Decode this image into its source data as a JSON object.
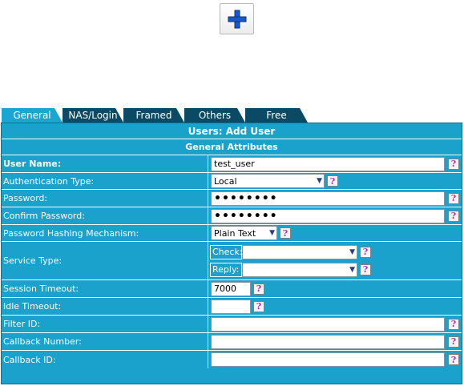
{
  "toolbar": {
    "add_icon": "plus-icon",
    "accent": "#1a57c9"
  },
  "tabs": [
    {
      "label": "General",
      "active": true
    },
    {
      "label": "NAS/Login",
      "active": false
    },
    {
      "label": "Framed",
      "active": false
    },
    {
      "label": "Others",
      "active": false
    },
    {
      "label": "Free",
      "active": false
    }
  ],
  "panel": {
    "title": "Users: Add User",
    "section": "General Attributes"
  },
  "form": {
    "user_name": {
      "label": "User Name:",
      "value": "test_user"
    },
    "auth_type": {
      "label": "Authentication Type:",
      "value": "Local"
    },
    "password": {
      "label": "Password:",
      "value": "••••••••"
    },
    "confirm_password": {
      "label": "Confirm Password:",
      "value": "••••••••"
    },
    "hashing": {
      "label": "Password Hashing Mechanism:",
      "value": "Plain Text"
    },
    "service_type": {
      "label": "Service Type:",
      "check_label": "Check:",
      "check_value": "",
      "reply_label": "Reply:",
      "reply_value": ""
    },
    "session_timeout": {
      "label": "Session Timeout:",
      "value": "7000"
    },
    "idle_timeout": {
      "label": "Idle Timeout:",
      "value": ""
    },
    "filter_id": {
      "label": "Filter ID:",
      "value": ""
    },
    "callback_number": {
      "label": "Callback Number:",
      "value": ""
    },
    "callback_id": {
      "label": "Callback ID:",
      "value": ""
    }
  },
  "help_glyph": "?",
  "colors": {
    "panel": "#1aa2cd",
    "tab_inactive": "#0b4a64",
    "tab_active": "#1aa6d1",
    "help": "#b030b0"
  }
}
